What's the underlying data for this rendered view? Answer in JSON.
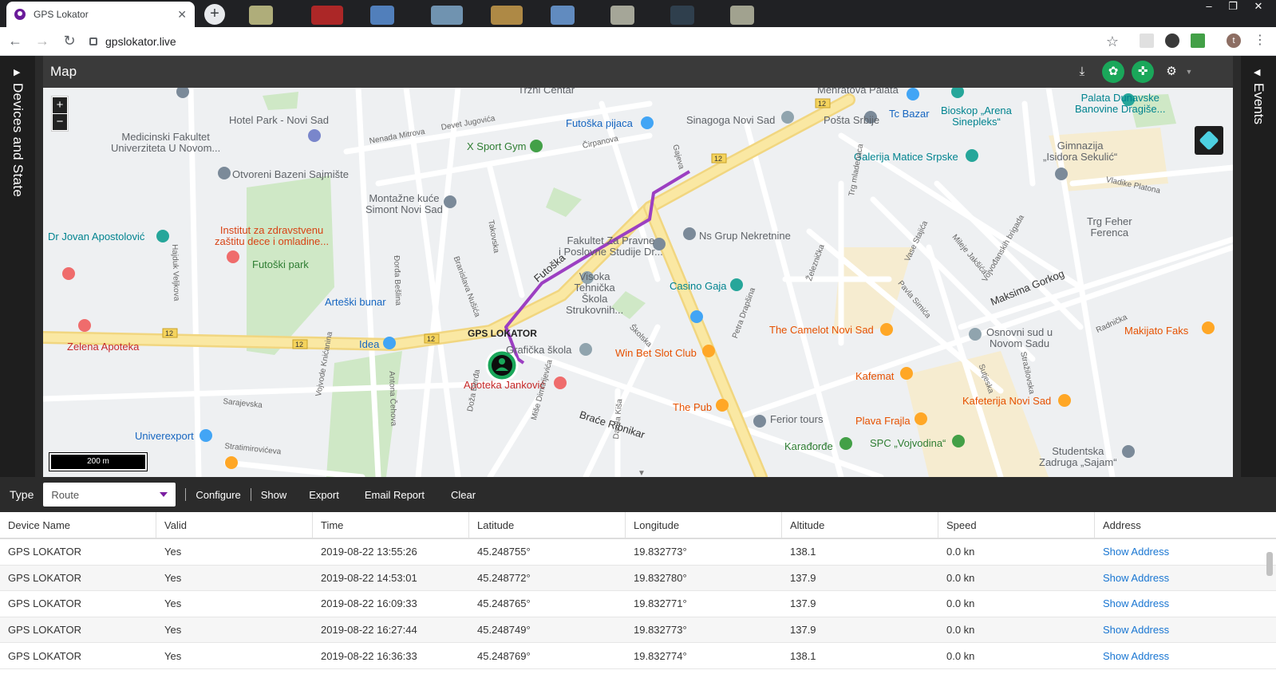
{
  "browser": {
    "tab_title": "GPS Lokator",
    "tab_close": "✕",
    "new_tab": "+",
    "url": "gpslokator.live",
    "profile_initial": "t",
    "back": "←",
    "forward": "→",
    "reload": "↻",
    "star": "☆",
    "menu": "⋮",
    "win_min": "–",
    "win_max": "❐",
    "win_close": "✕"
  },
  "sidebar_left": {
    "label": "Devices and State",
    "chevron": "▶"
  },
  "sidebar_right": {
    "label": "Events",
    "chevron": "◀"
  },
  "map": {
    "title": "Map",
    "zoom_in": "+",
    "zoom_out": "−",
    "scale": "200 m",
    "device_label": "GPS LOKATOR",
    "places": [
      {
        "name": "Medicinski Fakultet\nUniverziteta U Novom...",
        "color": "#5f6368"
      },
      {
        "name": "Hotel Park - Novi Sad",
        "color": "#5f6368"
      },
      {
        "name": "Otvoreni Bazeni Sajmište",
        "color": "#5f6368"
      },
      {
        "name": "Montažne kuće\nSimont Novi Sad",
        "color": "#5f6368"
      },
      {
        "name": "Dr Jovan Apostolović",
        "color": "#00838f"
      },
      {
        "name": "Institut za zdravstvenu\nzaštitu dece i omladine...",
        "color": "#d84315"
      },
      {
        "name": "Futoški park",
        "color": "#2e7d32"
      },
      {
        "name": "Arteški bunar",
        "color": "#1565c0"
      },
      {
        "name": "Zelena Apoteka",
        "color": "#c62828"
      },
      {
        "name": "Idea",
        "color": "#1565c0"
      },
      {
        "name": "Univerexport",
        "color": "#1565c0"
      },
      {
        "name": "X Sport Gym",
        "color": "#2e7d32"
      },
      {
        "name": "Futoška pijaca",
        "color": "#1565c0"
      },
      {
        "name": "Sinagoga Novi Sad",
        "color": "#5f6368"
      },
      {
        "name": "Pošta Srbije",
        "color": "#5f6368"
      },
      {
        "name": "Tc Bazar",
        "color": "#1565c0"
      },
      {
        "name": "Bioskop „Arena\nSinepleks“",
        "color": "#00838f"
      },
      {
        "name": "Galerija Matice Srpske",
        "color": "#00838f"
      },
      {
        "name": "Fakultet Za Pravne\ni Poslovne Studije Dr...",
        "color": "#5f6368"
      },
      {
        "name": "Ns Grup Nekretnine",
        "color": "#5f6368"
      },
      {
        "name": "Visoka\nTehnička\nŠkola\nStrukovnih...",
        "color": "#5f6368"
      },
      {
        "name": "Casino Gaja",
        "color": "#00838f"
      },
      {
        "name": "Grafička škola",
        "color": "#5f6368"
      },
      {
        "name": "Apoteka Janković",
        "color": "#c62828"
      },
      {
        "name": "Win Bet Slot Club",
        "color": "#e65100"
      },
      {
        "name": "The Camelot Novi Sad",
        "color": "#e65100"
      },
      {
        "name": "The Pub",
        "color": "#e65100"
      },
      {
        "name": "Kafemat",
        "color": "#e65100"
      },
      {
        "name": "Ferior tours",
        "color": "#5f6368"
      },
      {
        "name": "Plava Frajla",
        "color": "#e65100"
      },
      {
        "name": "Karađorđe",
        "color": "#2e7d32"
      },
      {
        "name": "SPC „Vojvodina“",
        "color": "#2e7d32"
      },
      {
        "name": "Osnovni sud u\nNovom Sadu",
        "color": "#5f6368"
      },
      {
        "name": "Kafeterija Novi Sad",
        "color": "#e65100"
      },
      {
        "name": "Makijato Faks",
        "color": "#e65100"
      },
      {
        "name": "Studentska\nZadruga „Sajam“",
        "color": "#5f6368"
      },
      {
        "name": "Trg Feher\nFerenca",
        "color": "#5f6368"
      },
      {
        "name": "Gimnazija\n„Isidora Sekulić“",
        "color": "#5f6368"
      },
      {
        "name": "Palata Dunavske\nBanovine Dragiše...",
        "color": "#00838f"
      },
      {
        "name": "Tržni Centar",
        "color": "#5f6368"
      },
      {
        "name": "Menratova Palata",
        "color": "#5f6368"
      }
    ],
    "streets": [
      "Futoška",
      "Maksima Gorkog",
      "Braće Ribnikar",
      "Hajduk Veljkova",
      "Stražilovska",
      "Gajeva",
      "Čirpanova",
      "Nenada Mitrova",
      "Devet Jugovića",
      "Sarajevska",
      "Stratimirovićeva",
      "Vojvode Knićanina",
      "Antona Čehova",
      "Doža Đerđa",
      "Miše Dimitrijevića",
      "Danila Kiša",
      "Petra Drapšina",
      "Pavla Simića",
      "Vase Stajića",
      "Železnička",
      "Trg mladenaca",
      "Mileje Jakšića",
      "Vojvođanskih brigada",
      "Sutjeska",
      "Radnička",
      "Vladike Platona",
      "Takovska",
      "Branislava Nušića",
      "Đorđa Bešlina",
      "Školska"
    ]
  },
  "report": {
    "type_label": "Type",
    "type_value": "Route",
    "buttons": [
      "Configure",
      "Show",
      "Export",
      "Email Report",
      "Clear"
    ],
    "columns": [
      "Device Name",
      "Valid",
      "Time",
      "Latitude",
      "Longitude",
      "Altitude",
      "Speed",
      "Address"
    ],
    "rows": [
      [
        "GPS LOKATOR",
        "Yes",
        "2019-08-22 13:55:26",
        "45.248755°",
        "19.832773°",
        "138.1",
        "0.0 kn",
        "Show Address"
      ],
      [
        "GPS LOKATOR",
        "Yes",
        "2019-08-22 14:53:01",
        "45.248772°",
        "19.832780°",
        "137.9",
        "0.0 kn",
        "Show Address"
      ],
      [
        "GPS LOKATOR",
        "Yes",
        "2019-08-22 16:09:33",
        "45.248765°",
        "19.832771°",
        "137.9",
        "0.0 kn",
        "Show Address"
      ],
      [
        "GPS LOKATOR",
        "Yes",
        "2019-08-22 16:27:44",
        "45.248749°",
        "19.832773°",
        "137.9",
        "0.0 kn",
        "Show Address"
      ],
      [
        "GPS LOKATOR",
        "Yes",
        "2019-08-22 16:36:33",
        "45.248769°",
        "19.832774°",
        "138.1",
        "0.0 kn",
        "Show Address"
      ]
    ]
  },
  "colors": {
    "route": "#9c3fc2",
    "accent": "#1aa75a",
    "link": "#1976d2"
  }
}
